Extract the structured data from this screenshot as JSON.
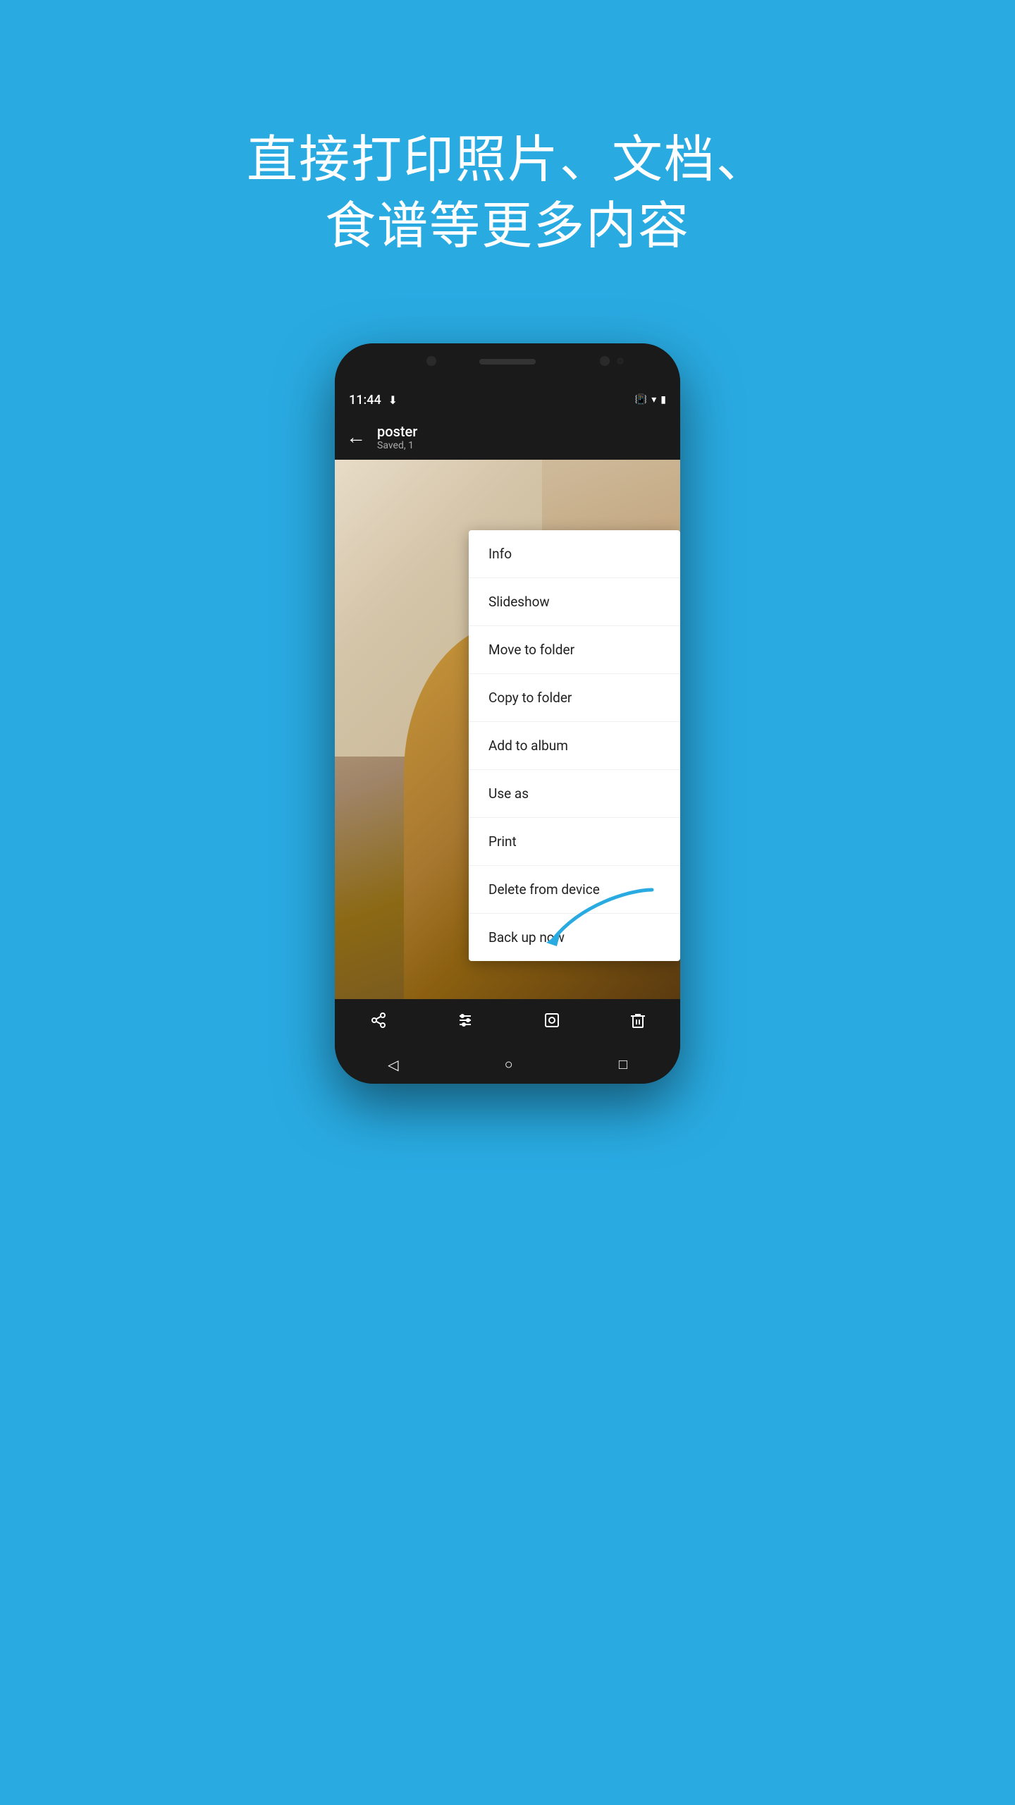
{
  "page": {
    "background_color": "#29ABE2",
    "title": "直接打印照片、文档、\n食谱等更多内容"
  },
  "status_bar": {
    "time": "11:44",
    "download_icon": "⬇",
    "vibrate_icon": "📳",
    "wifi_icon": "▼",
    "battery_icon": "🔋"
  },
  "app_bar": {
    "back_icon": "←",
    "title": "poster",
    "subtitle": "Saved, 1"
  },
  "context_menu": {
    "items": [
      {
        "id": "info",
        "label": "Info"
      },
      {
        "id": "slideshow",
        "label": "Slideshow"
      },
      {
        "id": "move-to-folder",
        "label": "Move to folder"
      },
      {
        "id": "copy-to-folder",
        "label": "Copy to folder"
      },
      {
        "id": "add-to-album",
        "label": "Add to album"
      },
      {
        "id": "use-as",
        "label": "Use as"
      },
      {
        "id": "print",
        "label": "Print"
      },
      {
        "id": "delete-from-device",
        "label": "Delete from device"
      },
      {
        "id": "back-up-now",
        "label": "Back up now"
      }
    ]
  },
  "bottom_nav": {
    "share_icon": "⟨",
    "edit_icon": "≡",
    "lens_icon": "⊙",
    "delete_icon": "🗑"
  },
  "system_nav": {
    "back": "◁",
    "home": "○",
    "recents": "□"
  }
}
